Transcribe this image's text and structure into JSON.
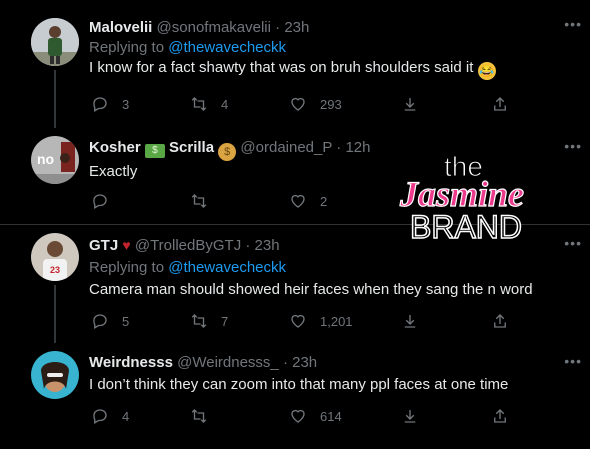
{
  "tweets": [
    {
      "name": "Malovelii",
      "handle": "@sonofmakavelii",
      "time": "23h",
      "replying_prefix": "Replying to",
      "replying_to": "@thewavecheckk",
      "text": "I know for a fact shawty that was on bruh shoulders said it",
      "replies": "3",
      "retweets": "4",
      "likes": "293"
    },
    {
      "name_part1": "Kosher",
      "name_part2": "Scrilla",
      "handle": "@ordained_P",
      "time": "12h",
      "avatar_text": "no",
      "text": "Exactly",
      "replies": "",
      "retweets": "",
      "likes": "2"
    },
    {
      "name": "GTJ",
      "handle": "@TrolledByGTJ",
      "time": "23h",
      "replying_prefix": "Replying to",
      "replying_to": "@thewavecheckk",
      "text": "Camera man should showed heir faces when they sang the n word",
      "replies": "5",
      "retweets": "7",
      "likes": "1,201"
    },
    {
      "name": "Weirdnesss",
      "handle": "@Weirdnesss_",
      "time": "23h",
      "text": "I don’t think they can zoom into that many ppl faces at one time",
      "replies": "4",
      "retweets": "",
      "likes": "614"
    }
  ],
  "watermark": {
    "line1": "the",
    "line2": "Jasmine",
    "line3": "BRAND"
  },
  "colors": {
    "background": "#000000",
    "text": "#e7e9ea",
    "muted": "#71767b",
    "link": "#1d9bf0",
    "watermark_pink": "#ee3a8c"
  },
  "icons": [
    "reply-icon",
    "retweet-icon",
    "like-icon",
    "share-icon",
    "more-icon"
  ]
}
